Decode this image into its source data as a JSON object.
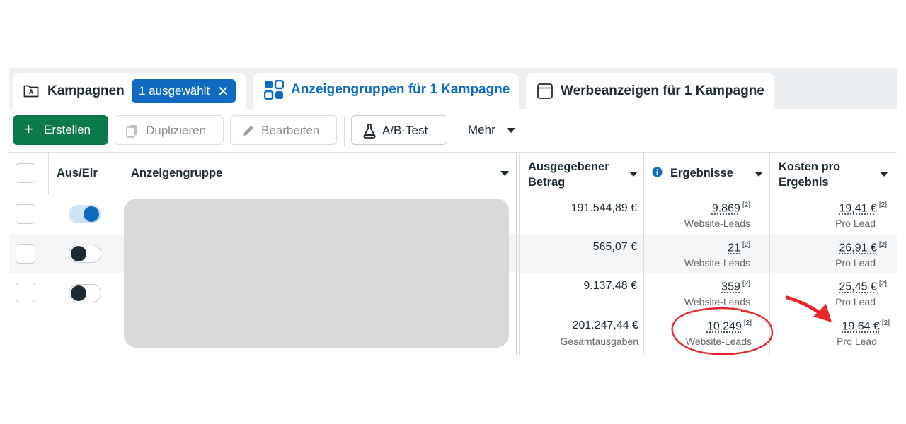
{
  "tabs": {
    "campaigns": {
      "label": "Kampagnen",
      "icon": "campaign-folder-icon"
    },
    "selection_badge": {
      "label": "1 ausgewählt",
      "close": "✕"
    },
    "adsets": {
      "label": "Anzeigengruppen für 1 Kampagne",
      "icon": "adset-grid-icon",
      "active": true
    },
    "ads": {
      "label": "Werbeanzeigen für 1 Kampagne",
      "icon": "ad-window-icon"
    }
  },
  "toolbar": {
    "create": "Erstellen",
    "duplicate": "Duplizieren",
    "edit": "Bearbeiten",
    "ab_test": "A/B-Test",
    "more": "Mehr"
  },
  "table": {
    "headers": {
      "onoff": "Aus/Eir",
      "adset": "Anzeigengruppe",
      "spend_line1": "Ausgegebener",
      "spend_line2": "Betrag",
      "results": "Ergebnisse",
      "cpr_line1": "Kosten pro",
      "cpr_line2": "Ergebnis"
    },
    "rows": [
      {
        "toggle_on": true,
        "spend": "191.544,89 €",
        "results": "9.869",
        "results_note": "[2]",
        "results_type": "Website-Leads",
        "cost": "19,41 €",
        "cost_note": "[2]",
        "cost_type": "Pro Lead"
      },
      {
        "toggle_on": false,
        "spend": "565,07 €",
        "results": "21",
        "results_note": "[2]",
        "results_type": "Website-Leads",
        "cost": "26,91 €",
        "cost_note": "[2]",
        "cost_type": "Pro Lead"
      },
      {
        "toggle_on": false,
        "spend": "9.137,48 €",
        "results": "359",
        "results_note": "[2]",
        "results_type": "Website-Leads",
        "cost": "25,45 €",
        "cost_note": "[2]",
        "cost_type": "Pro Lead"
      }
    ],
    "total": {
      "spend": "201.247,44 €",
      "spend_label": "Gesamtausgaben",
      "results": "10.249",
      "results_note": "[2]",
      "results_type": "Website-Leads",
      "cost": "19,64 €",
      "cost_note": "[2]",
      "cost_type": "Pro Lead"
    }
  },
  "colors": {
    "brand_blue": "#0f6bbf",
    "create_green": "#0a7a4b",
    "annotation_red": "#e8262b"
  }
}
